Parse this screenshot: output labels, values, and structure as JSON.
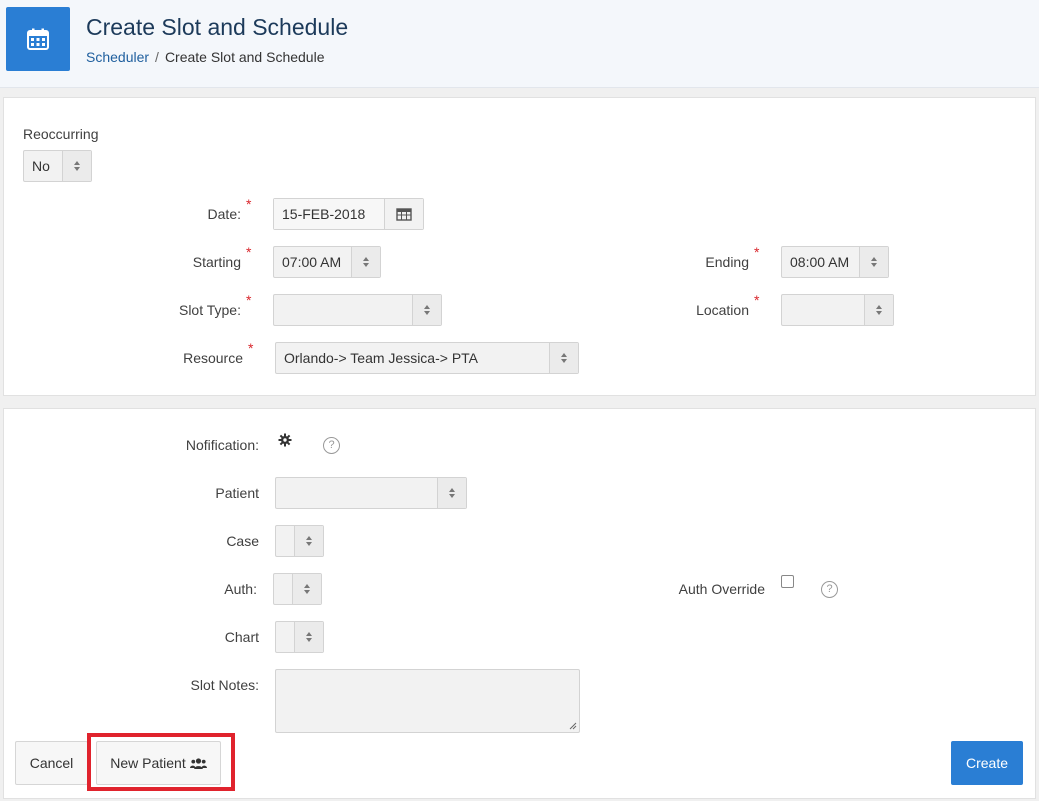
{
  "header": {
    "title": "Create Slot and Schedule",
    "breadcrumb": {
      "link": "Scheduler",
      "separator": "/",
      "current": "Create Slot and Schedule"
    },
    "icon": "calendar-icon"
  },
  "slot": {
    "reoccurring_label": "Reoccurring",
    "reoccurring_value": "No",
    "date_label": "Date:",
    "date_value": "15-FEB-2018",
    "starting_label": "Starting",
    "starting_value": "07:00 AM",
    "ending_label": "Ending",
    "ending_value": "08:00 AM",
    "slot_type_label": "Slot Type:",
    "slot_type_value": "",
    "location_label": "Location",
    "location_value": "",
    "resource_label": "Resource",
    "resource_value": "Orlando-> Team Jessica-> PTA",
    "required_mark": "*"
  },
  "details": {
    "notification_label": "Nofification:",
    "patient_label": "Patient",
    "patient_value": "",
    "case_label": "Case",
    "auth_label": "Auth:",
    "auth_override_label": "Auth Override",
    "chart_label": "Chart",
    "slot_notes_label": "Slot Notes:",
    "help_glyph": "?"
  },
  "actions": {
    "cancel_label": "Cancel",
    "new_patient_label": "New Patient",
    "create_label": "Create"
  },
  "colors": {
    "primary": "#2a7ed4",
    "required": "#d9262c",
    "highlight": "#e0232d"
  }
}
